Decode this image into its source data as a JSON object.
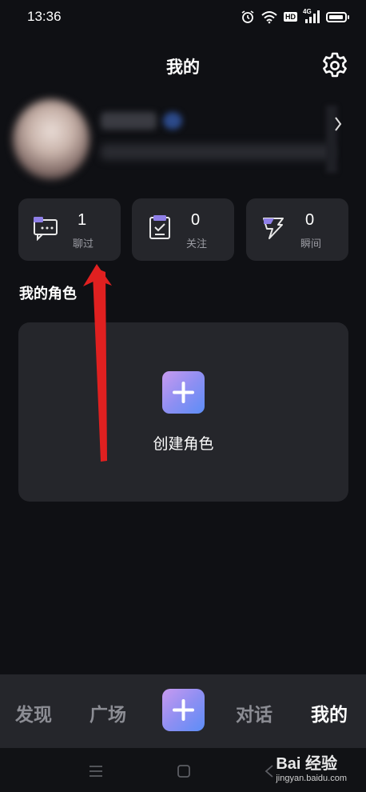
{
  "status_bar": {
    "time": "13:36",
    "hd": "HD",
    "network": "4G",
    "icons": [
      "alarm-icon",
      "wifi-icon",
      "signal-icon",
      "battery-icon"
    ]
  },
  "header": {
    "title": "我的",
    "settings_icon": "gear-icon"
  },
  "stats": [
    {
      "value": "1",
      "label": "聊过",
      "icon": "chat-bubble-icon"
    },
    {
      "value": "0",
      "label": "关注",
      "icon": "clipboard-check-icon"
    },
    {
      "value": "0",
      "label": "瞬间",
      "icon": "lightning-icon"
    }
  ],
  "roles": {
    "section_title": "我的角色",
    "create_label": "创建角色"
  },
  "bottom_nav": {
    "items": [
      "发现",
      "广场",
      "对话",
      "我的"
    ],
    "active": "我的"
  },
  "watermark": {
    "brand": "Bai 经验",
    "url": "jingyan.baidu.com"
  },
  "colors": {
    "background": "#0f1014",
    "card": "#25262b",
    "accent_gradient_start": "#c89af0",
    "accent_gradient_end": "#5c8ef7",
    "annotation_arrow": "#e02020"
  }
}
